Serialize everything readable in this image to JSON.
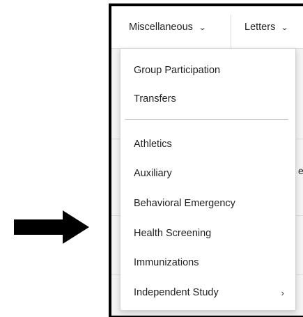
{
  "menubar": {
    "tabs": [
      {
        "label": "Miscellaneous",
        "chevron": "chevron-down-icon",
        "expanded": true
      },
      {
        "label": "Letters",
        "chevron": "chevron-down-icon",
        "expanded": false
      }
    ]
  },
  "dropdown": {
    "group1": [
      {
        "label": "Group Participation"
      },
      {
        "label": "Transfers"
      }
    ],
    "group2": [
      {
        "label": "Athletics"
      },
      {
        "label": "Auxiliary"
      },
      {
        "label": "Behavioral Emergency"
      },
      {
        "label": "Health Screening"
      },
      {
        "label": "Immunizations"
      },
      {
        "label": "Independent Study",
        "has_submenu": true
      }
    ]
  },
  "glyphs": {
    "chevron_down": "⌄",
    "chevron_right": "›",
    "bg_char_right": "e"
  },
  "annotation": {
    "arrow_icon": "right-arrow-icon",
    "arrow_color": "#000000"
  }
}
